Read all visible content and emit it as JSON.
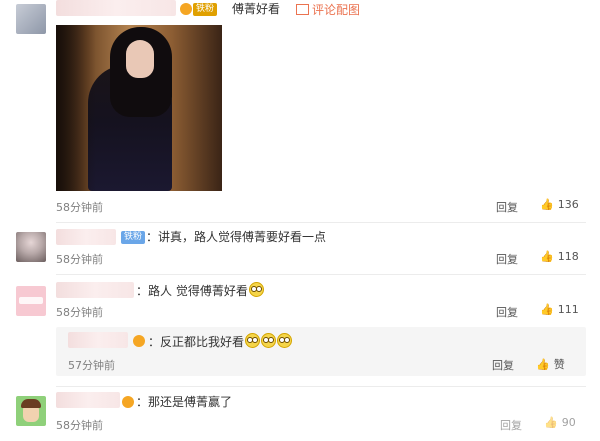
{
  "comments": [
    {
      "badge": "铁粉",
      "text": "傅菁好看",
      "pic_link": "评论配图",
      "time": "58分钟前",
      "reply": "回复",
      "likes": "136"
    },
    {
      "badge": "铁粉",
      "text": "讲真，路人觉得傅菁要好看一点",
      "time": "58分钟前",
      "reply": "回复",
      "likes": "118"
    },
    {
      "text": "路人  觉得傅菁好看",
      "time": "58分钟前",
      "reply": "回复",
      "likes": "111"
    },
    {
      "text": "那还是傅菁赢了",
      "time": "58分钟前",
      "reply": "回复",
      "likes": "90"
    }
  ],
  "sub_reply": {
    "text": "反正都比我好看",
    "time": "57分钟前",
    "reply": "回复",
    "likes": "赞"
  },
  "colors": {
    "link": "#eb7350",
    "badge_blue": "#6aa6e8",
    "gray_text": "#808080"
  }
}
